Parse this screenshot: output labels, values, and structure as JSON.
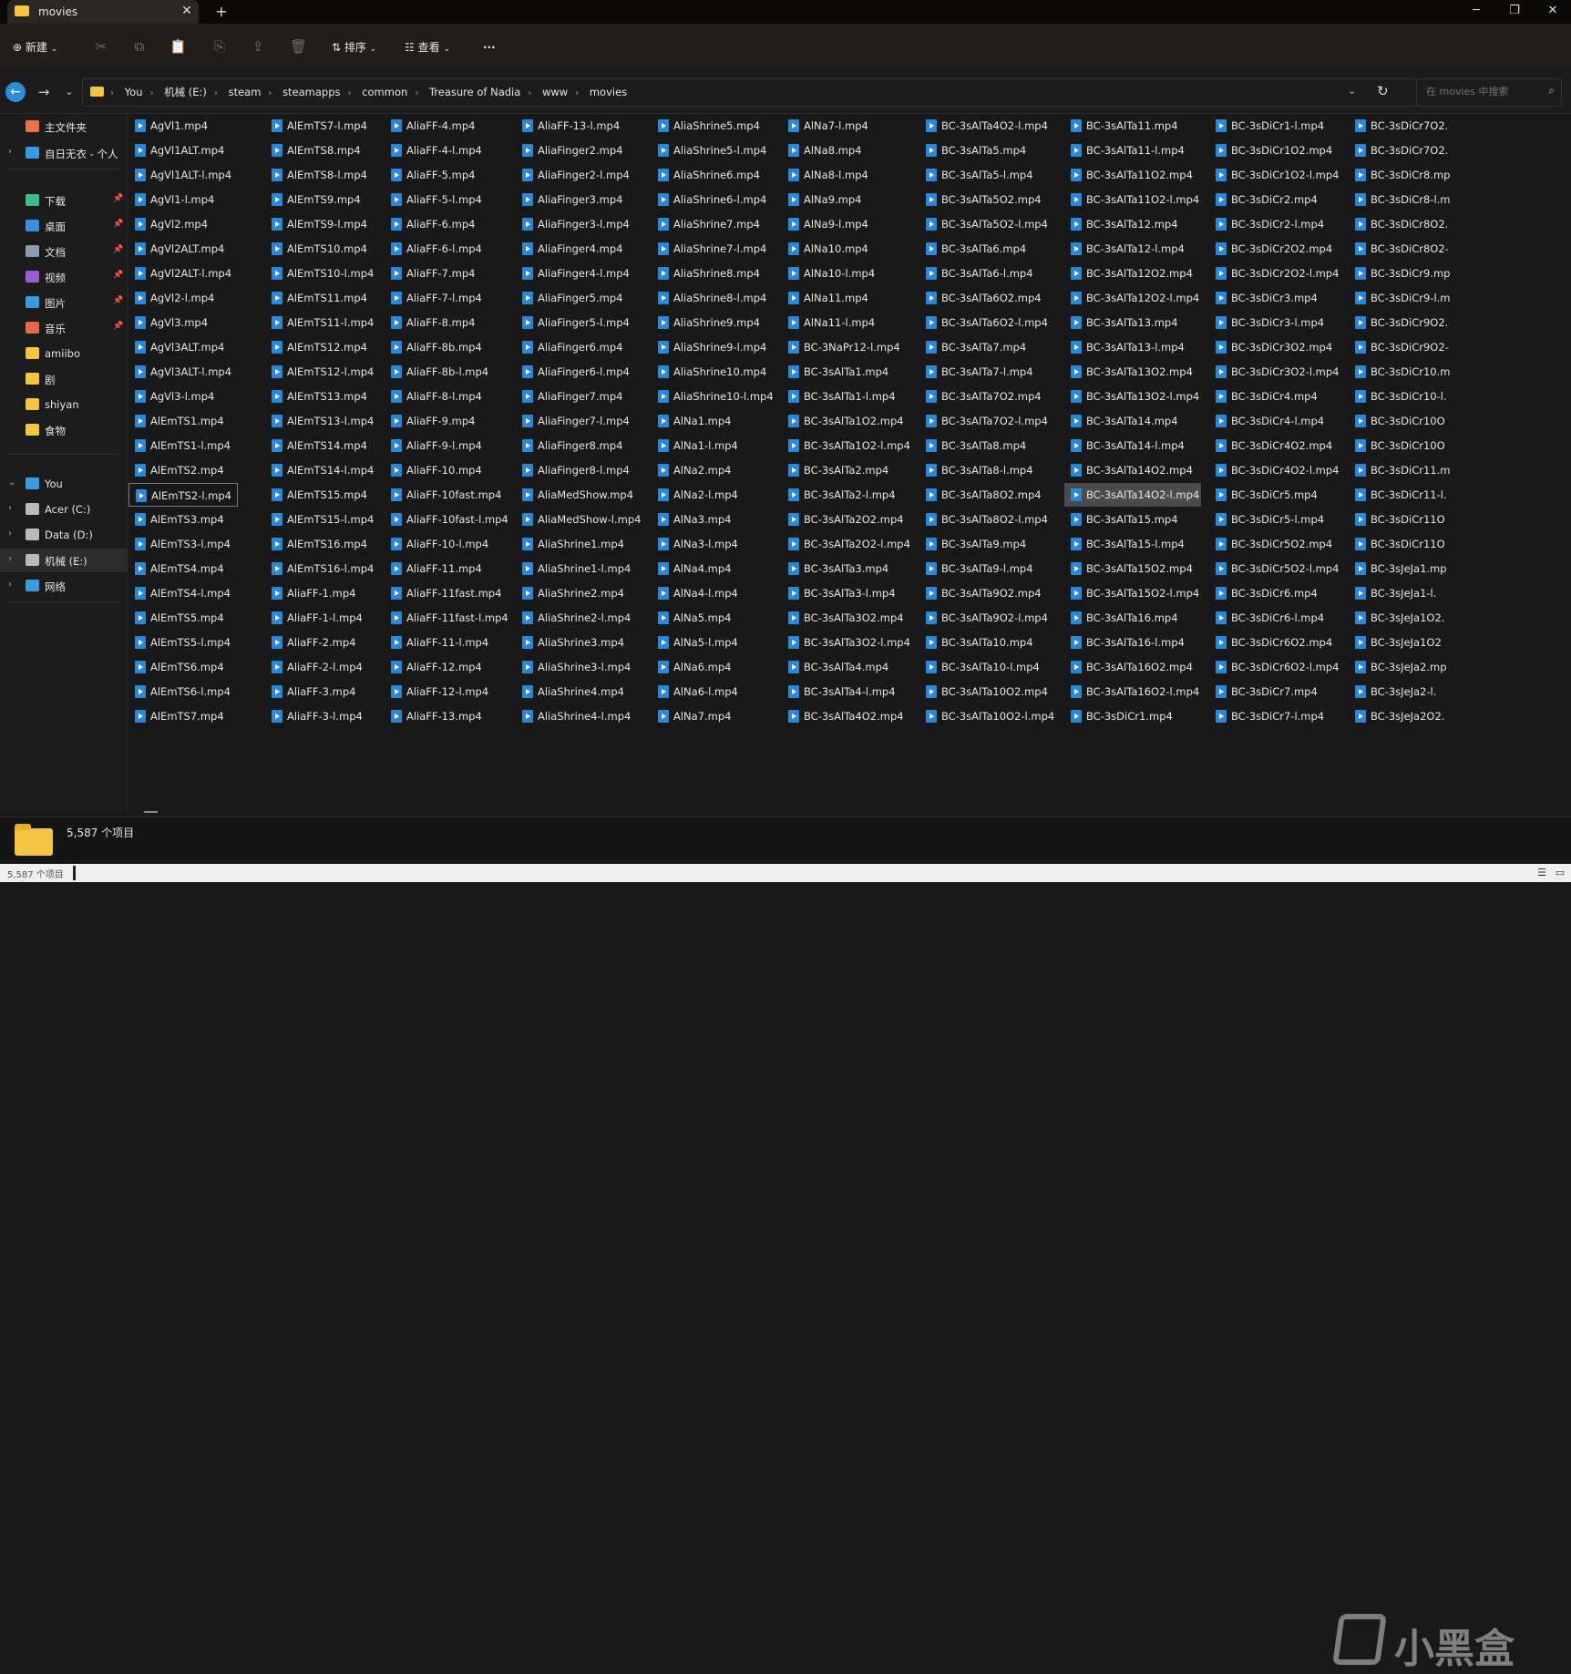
{
  "window": {
    "tab_title": "movies",
    "tab_close": "✕",
    "new_tab": "+",
    "minimize": "─",
    "restore": "❐",
    "close": "✕"
  },
  "toolbar": {
    "new_label": "新建",
    "sort_label": "排序",
    "view_label": "查看",
    "more_label": "···"
  },
  "address": {
    "breadcrumbs": [
      "You",
      "机械 (E:)",
      "steam",
      "steamapps",
      "common",
      "Treasure of Nadia",
      "www",
      "movies"
    ],
    "search_placeholder": "在 movies 中搜索"
  },
  "sidebar": {
    "items": [
      {
        "label": "主文件夹",
        "icon": "home-icon",
        "color": "#e8734a",
        "chevron": ""
      },
      {
        "label": "自日无衣 - 个人",
        "icon": "cloud-icon",
        "color": "#3b9be0",
        "chevron": "›"
      },
      {
        "label": "下载",
        "icon": "download-icon",
        "color": "#3dbd8c",
        "pin": true
      },
      {
        "label": "桌面",
        "icon": "desktop-icon",
        "color": "#3b8fe0",
        "pin": true
      },
      {
        "label": "文档",
        "icon": "document-icon",
        "color": "#8a9ab0",
        "pin": true
      },
      {
        "label": "视频",
        "icon": "video-icon",
        "color": "#9a5ad8",
        "pin": true
      },
      {
        "label": "图片",
        "icon": "picture-icon",
        "color": "#3b9be0",
        "pin": true
      },
      {
        "label": "音乐",
        "icon": "music-icon",
        "color": "#e06a4a",
        "pin": true
      },
      {
        "label": "amiibo",
        "icon": "folder-icon",
        "color": "#f4c542"
      },
      {
        "label": "剧",
        "icon": "folder-icon",
        "color": "#f4c542"
      },
      {
        "label": "shiyan",
        "icon": "folder-icon",
        "color": "#f4c542"
      },
      {
        "label": "食物",
        "icon": "folder-icon",
        "color": "#f4c542"
      },
      {
        "label": "You",
        "icon": "computer-icon",
        "color": "#3b9be0",
        "chevron": "⌄"
      },
      {
        "label": "Acer (C:)",
        "icon": "drive-icon",
        "color": "#bbbbbb",
        "chevron": "›"
      },
      {
        "label": "Data (D:)",
        "icon": "drive-icon",
        "color": "#bbbbbb",
        "chevron": "›"
      },
      {
        "label": "机械 (E:)",
        "icon": "drive-icon",
        "color": "#bbbbbb",
        "chevron": "›",
        "selected": true
      },
      {
        "label": "网络",
        "icon": "network-icon",
        "color": "#3b9be0",
        "chevron": "›"
      }
    ]
  },
  "files": {
    "columns": [
      [
        "AgVl1.mp4",
        "AgVl1ALT.mp4",
        "AgVl1ALT-l.mp4",
        "AgVl1-l.mp4",
        "AgVl2.mp4",
        "AgVl2ALT.mp4",
        "AgVl2ALT-l.mp4",
        "AgVl2-l.mp4",
        "AgVl3.mp4",
        "AgVl3ALT.mp4",
        "AgVl3ALT-l.mp4",
        "AgVl3-l.mp4",
        "AlEmTS1.mp4",
        "AlEmTS1-l.mp4",
        "AlEmTS2.mp4",
        "AlEmTS2-l.mp4",
        "AlEmTS3.mp4",
        "AlEmTS3-l.mp4",
        "AlEmTS4.mp4",
        "AlEmTS4-l.mp4",
        "AlEmTS5.mp4",
        "AlEmTS5-l.mp4",
        "AlEmTS6.mp4",
        "AlEmTS6-l.mp4",
        "AlEmTS7.mp4"
      ],
      [
        "AlEmTS7-l.mp4",
        "AlEmTS8.mp4",
        "AlEmTS8-l.mp4",
        "AlEmTS9.mp4",
        "AlEmTS9-l.mp4",
        "AlEmTS10.mp4",
        "AlEmTS10-l.mp4",
        "AlEmTS11.mp4",
        "AlEmTS11-l.mp4",
        "AlEmTS12.mp4",
        "AlEmTS12-l.mp4",
        "AlEmTS13.mp4",
        "AlEmTS13-l.mp4",
        "AlEmTS14.mp4",
        "AlEmTS14-l.mp4",
        "AlEmTS15.mp4",
        "AlEmTS15-l.mp4",
        "AlEmTS16.mp4",
        "AlEmTS16-l.mp4",
        "AliaFF-1.mp4",
        "AliaFF-1-l.mp4",
        "AliaFF-2.mp4",
        "AliaFF-2-l.mp4",
        "AliaFF-3.mp4",
        "AliaFF-3-l.mp4"
      ],
      [
        "AliaFF-4.mp4",
        "AliaFF-4-l.mp4",
        "AliaFF-5.mp4",
        "AliaFF-5-l.mp4",
        "AliaFF-6.mp4",
        "AliaFF-6-l.mp4",
        "AliaFF-7.mp4",
        "AliaFF-7-l.mp4",
        "AliaFF-8.mp4",
        "AliaFF-8b.mp4",
        "AliaFF-8b-l.mp4",
        "AliaFF-8-l.mp4",
        "AliaFF-9.mp4",
        "AliaFF-9-l.mp4",
        "AliaFF-10.mp4",
        "AliaFF-10fast.mp4",
        "AliaFF-10fast-l.mp4",
        "AliaFF-10-l.mp4",
        "AliaFF-11.mp4",
        "AliaFF-11fast.mp4",
        "AliaFF-11fast-l.mp4",
        "AliaFF-11-l.mp4",
        "AliaFF-12.mp4",
        "AliaFF-12-l.mp4",
        "AliaFF-13.mp4"
      ],
      [
        "AliaFF-13-l.mp4",
        "AliaFinger2.mp4",
        "AliaFinger2-l.mp4",
        "AliaFinger3.mp4",
        "AliaFinger3-l.mp4",
        "AliaFinger4.mp4",
        "AliaFinger4-l.mp4",
        "AliaFinger5.mp4",
        "AliaFinger5-l.mp4",
        "AliaFinger6.mp4",
        "AliaFinger6-l.mp4",
        "AliaFinger7.mp4",
        "AliaFinger7-l.mp4",
        "AliaFinger8.mp4",
        "AliaFinger8-l.mp4",
        "AliaMedShow.mp4",
        "AliaMedShow-l.mp4",
        "AliaShrine1.mp4",
        "AliaShrine1-l.mp4",
        "AliaShrine2.mp4",
        "AliaShrine2-l.mp4",
        "AliaShrine3.mp4",
        "AliaShrine3-l.mp4",
        "AliaShrine4.mp4",
        "AliaShrine4-l.mp4"
      ],
      [
        "AliaShrine5.mp4",
        "AliaShrine5-l.mp4",
        "AliaShrine6.mp4",
        "AliaShrine6-l.mp4",
        "AliaShrine7.mp4",
        "AliaShrine7-l.mp4",
        "AliaShrine8.mp4",
        "AliaShrine8-l.mp4",
        "AliaShrine9.mp4",
        "AliaShrine9-l.mp4",
        "AliaShrine10.mp4",
        "AliaShrine10-l.mp4",
        "AlNa1.mp4",
        "AlNa1-l.mp4",
        "AlNa2.mp4",
        "AlNa2-l.mp4",
        "AlNa3.mp4",
        "AlNa3-l.mp4",
        "AlNa4.mp4",
        "AlNa4-l.mp4",
        "AlNa5.mp4",
        "AlNa5-l.mp4",
        "AlNa6.mp4",
        "AlNa6-l.mp4",
        "AlNa7.mp4"
      ],
      [
        "AlNa7-l.mp4",
        "AlNa8.mp4",
        "AlNa8-l.mp4",
        "AlNa9.mp4",
        "AlNa9-l.mp4",
        "AlNa10.mp4",
        "AlNa10-l.mp4",
        "AlNa11.mp4",
        "AlNa11-l.mp4",
        "BC-3NaPr12-l.mp4",
        "BC-3sAlTa1.mp4",
        "BC-3sAlTa1-l.mp4",
        "BC-3sAlTa1O2.mp4",
        "BC-3sAlTa1O2-l.mp4",
        "BC-3sAlTa2.mp4",
        "BC-3sAlTa2-l.mp4",
        "BC-3sAlTa2O2.mp4",
        "BC-3sAlTa2O2-l.mp4",
        "BC-3sAlTa3.mp4",
        "BC-3sAlTa3-l.mp4",
        "BC-3sAlTa3O2.mp4",
        "BC-3sAlTa3O2-l.mp4",
        "BC-3sAlTa4.mp4",
        "BC-3sAlTa4-l.mp4",
        "BC-3sAlTa4O2.mp4"
      ],
      [
        "BC-3sAlTa4O2-l.mp4",
        "BC-3sAlTa5.mp4",
        "BC-3sAlTa5-l.mp4",
        "BC-3sAlTa5O2.mp4",
        "BC-3sAlTa5O2-l.mp4",
        "BC-3sAlTa6.mp4",
        "BC-3sAlTa6-l.mp4",
        "BC-3sAlTa6O2.mp4",
        "BC-3sAlTa6O2-l.mp4",
        "BC-3sAlTa7.mp4",
        "BC-3sAlTa7-l.mp4",
        "BC-3sAlTa7O2.mp4",
        "BC-3sAlTa7O2-l.mp4",
        "BC-3sAlTa8.mp4",
        "BC-3sAlTa8-l.mp4",
        "BC-3sAlTa8O2.mp4",
        "BC-3sAlTa8O2-l.mp4",
        "BC-3sAlTa9.mp4",
        "BC-3sAlTa9-l.mp4",
        "BC-3sAlTa9O2.mp4",
        "BC-3sAlTa9O2-l.mp4",
        "BC-3sAlTa10.mp4",
        "BC-3sAlTa10-l.mp4",
        "BC-3sAlTa10O2.mp4",
        "BC-3sAlTa10O2-l.mp4"
      ],
      [
        "BC-3sAlTa11.mp4",
        "BC-3sAlTa11-l.mp4",
        "BC-3sAlTa11O2.mp4",
        "BC-3sAlTa11O2-l.mp4",
        "BC-3sAlTa12.mp4",
        "BC-3sAlTa12-l.mp4",
        "BC-3sAlTa12O2.mp4",
        "BC-3sAlTa12O2-l.mp4",
        "BC-3sAlTa13.mp4",
        "BC-3sAlTa13-l.mp4",
        "BC-3sAlTa13O2.mp4",
        "BC-3sAlTa13O2-l.mp4",
        "BC-3sAlTa14.mp4",
        "BC-3sAlTa14-l.mp4",
        "BC-3sAlTa14O2.mp4",
        "BC-3sAlTa14O2-l.mp4",
        "BC-3sAlTa15.mp4",
        "BC-3sAlTa15-l.mp4",
        "BC-3sAlTa15O2.mp4",
        "BC-3sAlTa15O2-l.mp4",
        "BC-3sAlTa16.mp4",
        "BC-3sAlTa16-l.mp4",
        "BC-3sAlTa16O2.mp4",
        "BC-3sAlTa16O2-l.mp4",
        "BC-3sDiCr1.mp4"
      ],
      [
        "BC-3sDiCr1-l.mp4",
        "BC-3sDiCr1O2.mp4",
        "BC-3sDiCr1O2-l.mp4",
        "BC-3sDiCr2.mp4",
        "BC-3sDiCr2-l.mp4",
        "BC-3sDiCr2O2.mp4",
        "BC-3sDiCr2O2-l.mp4",
        "BC-3sDiCr3.mp4",
        "BC-3sDiCr3-l.mp4",
        "BC-3sDiCr3O2.mp4",
        "BC-3sDiCr3O2-l.mp4",
        "BC-3sDiCr4.mp4",
        "BC-3sDiCr4-l.mp4",
        "BC-3sDiCr4O2.mp4",
        "BC-3sDiCr4O2-l.mp4",
        "BC-3sDiCr5.mp4",
        "BC-3sDiCr5-l.mp4",
        "BC-3sDiCr5O2.mp4",
        "BC-3sDiCr5O2-l.mp4",
        "BC-3sDiCr6.mp4",
        "BC-3sDiCr6-l.mp4",
        "BC-3sDiCr6O2.mp4",
        "BC-3sDiCr6O2-l.mp4",
        "BC-3sDiCr7.mp4",
        "BC-3sDiCr7-l.mp4"
      ],
      [
        "BC-3sDiCr7O2.",
        "BC-3sDiCr7O2.",
        "BC-3sDiCr8.mp",
        "BC-3sDiCr8-l.m",
        "BC-3sDiCr8O2.",
        "BC-3sDiCr8O2-",
        "BC-3sDiCr9.mp",
        "BC-3sDiCr9-l.m",
        "BC-3sDiCr9O2.",
        "BC-3sDiCr9O2-",
        "BC-3sDiCr10.m",
        "BC-3sDiCr10-l.",
        "BC-3sDiCr10O",
        "BC-3sDiCr10O",
        "BC-3sDiCr11.m",
        "BC-3sDiCr11-l.",
        "BC-3sDiCr11O",
        "BC-3sDiCr11O",
        "BC-3sJeJa1.mp",
        "BC-3sJeJa1-l.",
        "BC-3sJeJa1O2.",
        "BC-3sJeJa1O2",
        "BC-3sJeJa2.mp",
        "BC-3sJeJa2-l.",
        "BC-3sJeJa2O2."
      ]
    ],
    "selected": {
      "col": 7,
      "row": 15
    },
    "focused": {
      "col": 0,
      "row": 15
    }
  },
  "details": {
    "item_count": "5,587 个项目"
  },
  "status": {
    "text": "5,587 个项目"
  },
  "watermark": {
    "text": "小黑盒"
  },
  "colors": {
    "accent": "#2f8dd8",
    "folder": "#f4c542",
    "video_icon": "#2b88d8"
  }
}
